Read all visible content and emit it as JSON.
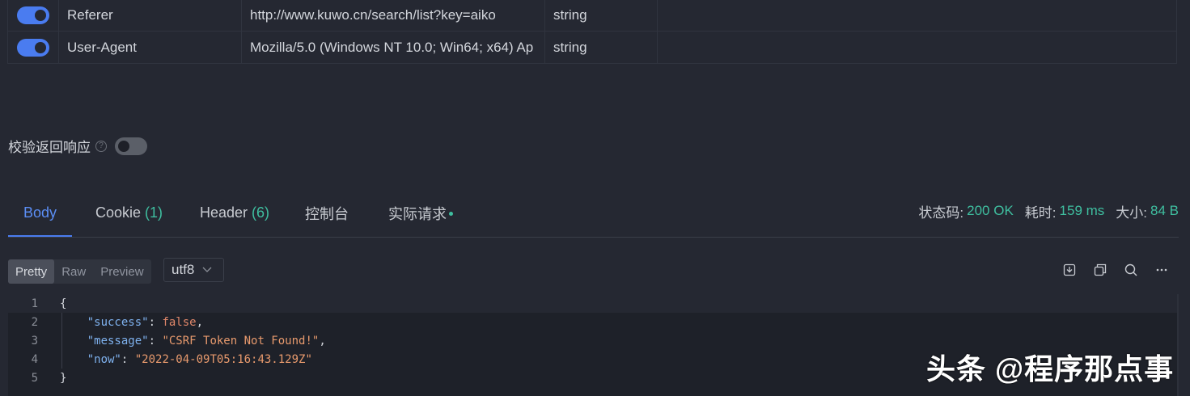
{
  "headers": [
    {
      "enabled": true,
      "key": "Referer",
      "value": "http://www.kuwo.cn/search/list?key=aiko",
      "type": "string"
    },
    {
      "enabled": true,
      "key": "User-Agent",
      "value": "Mozilla/5.0 (Windows NT 10.0; Win64; x64) Ap",
      "type": "string"
    }
  ],
  "validate": {
    "label": "校验返回响应",
    "help": "?",
    "enabled": false
  },
  "tabs": {
    "body": "Body",
    "cookie": "Cookie",
    "cookie_count": "(1)",
    "header": "Header",
    "header_count": "(6)",
    "console": "控制台",
    "actual": "实际请求"
  },
  "status": {
    "code_label": "状态码:",
    "code_value": "200 OK",
    "time_label": "耗时:",
    "time_value": "159 ms",
    "size_label": "大小:",
    "size_value": "84 B"
  },
  "view_modes": {
    "pretty": "Pretty",
    "raw": "Raw",
    "preview": "Preview",
    "selected": "Pretty"
  },
  "encoding": {
    "value": "utf8"
  },
  "toolbar_icons": [
    "download-icon",
    "copy-icon",
    "search-icon",
    "more-icon"
  ],
  "code_lines": {
    "n1": "1",
    "n2": "2",
    "n3": "3",
    "n4": "4",
    "n5": "5",
    "open": "{",
    "success_key": "\"success\"",
    "success_val": "false",
    "message_key": "\"message\"",
    "message_val": "\"CSRF Token Not Found!\"",
    "now_key": "\"now\"",
    "now_val": "\"2022-04-09T05:16:43.129Z\"",
    "close": "}"
  },
  "watermark": "头条 @程序那点事",
  "colors": {
    "accent": "#4a7cf0",
    "success": "#3fbfa0",
    "string": "#e89a6d",
    "key": "#7fb2ef"
  }
}
